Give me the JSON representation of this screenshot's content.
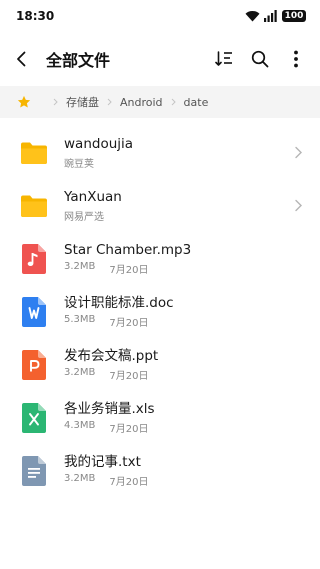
{
  "status_bar": {
    "time": "18:30",
    "battery": "100"
  },
  "header": {
    "title": "全部文件",
    "icons": [
      "back-icon",
      "sort-icon",
      "search-icon",
      "more-icon"
    ]
  },
  "breadcrumb": {
    "icon": "star-icon",
    "items": [
      "存储盘",
      "Android",
      "date"
    ]
  },
  "files": [
    {
      "name": "wandoujia",
      "subtitle": "豌豆荚",
      "type": "folder",
      "icon": "folder-icon"
    },
    {
      "name": "YanXuan",
      "subtitle": "网易严选",
      "type": "folder",
      "icon": "folder-icon"
    },
    {
      "name": "Star Chamber.mp3",
      "size": "3.2MB",
      "date": "7月20日",
      "type": "audio",
      "icon": "audio-file-icon",
      "letter": "♫",
      "color": "#ef5350"
    },
    {
      "name": "设计职能标准.doc",
      "size": "5.3MB",
      "date": "7月20日",
      "type": "doc",
      "icon": "word-file-icon",
      "letter": "W",
      "color": "#2e7ff0"
    },
    {
      "name": "发布会文稿.ppt",
      "size": "3.2MB",
      "date": "7月20日",
      "type": "ppt",
      "icon": "ppt-file-icon",
      "letter": "P",
      "color": "#f4612e"
    },
    {
      "name": "各业务销量.xls",
      "size": "4.3MB",
      "date": "7月20日",
      "type": "xls",
      "icon": "excel-file-icon",
      "letter": "X",
      "color": "#2bb673"
    },
    {
      "name": "我的记事.txt",
      "size": "3.2MB",
      "date": "7月20日",
      "type": "txt",
      "icon": "text-file-icon",
      "letter": "",
      "color": "#7f97b2"
    }
  ],
  "colors": {
    "folder": "#f7b500",
    "star": "#f7b500",
    "breadcrumb_bg": "#f4f4f4"
  }
}
